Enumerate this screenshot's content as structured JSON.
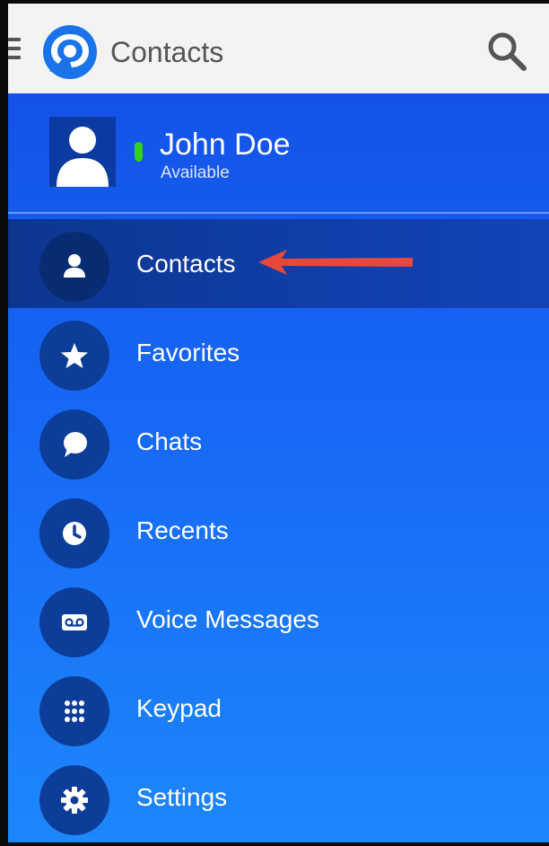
{
  "appbar": {
    "title": "Contacts",
    "menu_icon": "hamburger-menu-icon",
    "logo_icon": "chat-bubble-logo",
    "search_icon": "search-icon"
  },
  "profile": {
    "name": "John Doe",
    "status": "Available",
    "status_color": "#32d11b"
  },
  "menu": {
    "items": [
      {
        "label": "Contacts",
        "icon": "person-icon",
        "selected": true
      },
      {
        "label": "Favorites",
        "icon": "star-icon"
      },
      {
        "label": "Chats",
        "icon": "chat-bubble-icon"
      },
      {
        "label": "Recents",
        "icon": "clock-icon"
      },
      {
        "label": "Voice Messages",
        "icon": "voicemail-icon"
      },
      {
        "label": "Keypad",
        "icon": "dialpad-icon"
      },
      {
        "label": "Settings",
        "icon": "gear-icon"
      }
    ]
  },
  "annotation": {
    "arrow_color": "#e8473c"
  },
  "colors": {
    "drawer_top": "#1452e8",
    "drawer_bottom": "#1d87fb",
    "icon_circle": "#0c3d98",
    "appbar": "#f3f3f3"
  }
}
